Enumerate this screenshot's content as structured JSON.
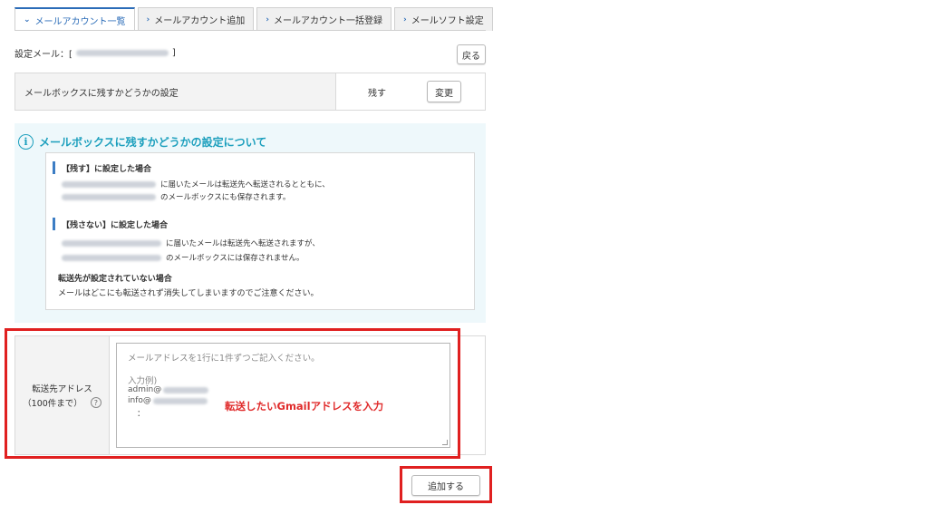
{
  "tabs": [
    {
      "label": "メールアカウント一覧",
      "active": true
    },
    {
      "label": "メールアカウント追加",
      "active": false
    },
    {
      "label": "メールアカウント一括登録",
      "active": false
    },
    {
      "label": "メールソフト設定",
      "active": false
    }
  ],
  "setting_mail": {
    "prefix": "設定メール：[",
    "suffix": "]"
  },
  "back_label": "戻る",
  "mailbox_setting": {
    "label": "メールボックスに残すかどうかの設定",
    "value": "残す",
    "change_label": "変更"
  },
  "info": {
    "title": "メールボックスに残すかどうかの設定について",
    "keep": {
      "heading": "【残す】に設定した場合",
      "line1": "に届いたメールは転送先へ転送されるとともに、",
      "line2": "のメールボックスにも保存されます。"
    },
    "dont_keep": {
      "heading": "【残さない】に設定した場合",
      "line1": "に届いたメールは転送先へ転送されますが、",
      "line2": "のメールボックスには保存されません。"
    },
    "no_dest": {
      "heading": "転送先が設定されていない場合",
      "text": "メールはどこにも転送されず消失してしまいますのでご注意ください。"
    }
  },
  "forward": {
    "label": "転送先アドレス",
    "limit": "（100件まで）",
    "help_icon": "?",
    "placeholder": "メールアドレスを1行に1件ずつご記入ください。",
    "example_heading": "入力例)",
    "example1": "admin@",
    "example2": "info@",
    "example3": "："
  },
  "annotation": "転送したいGmailアドレスを入力",
  "add_label": "追加する",
  "colors": {
    "accent": "#2b6cb8",
    "info": "#1c9fbd",
    "highlight": "#e02020"
  }
}
